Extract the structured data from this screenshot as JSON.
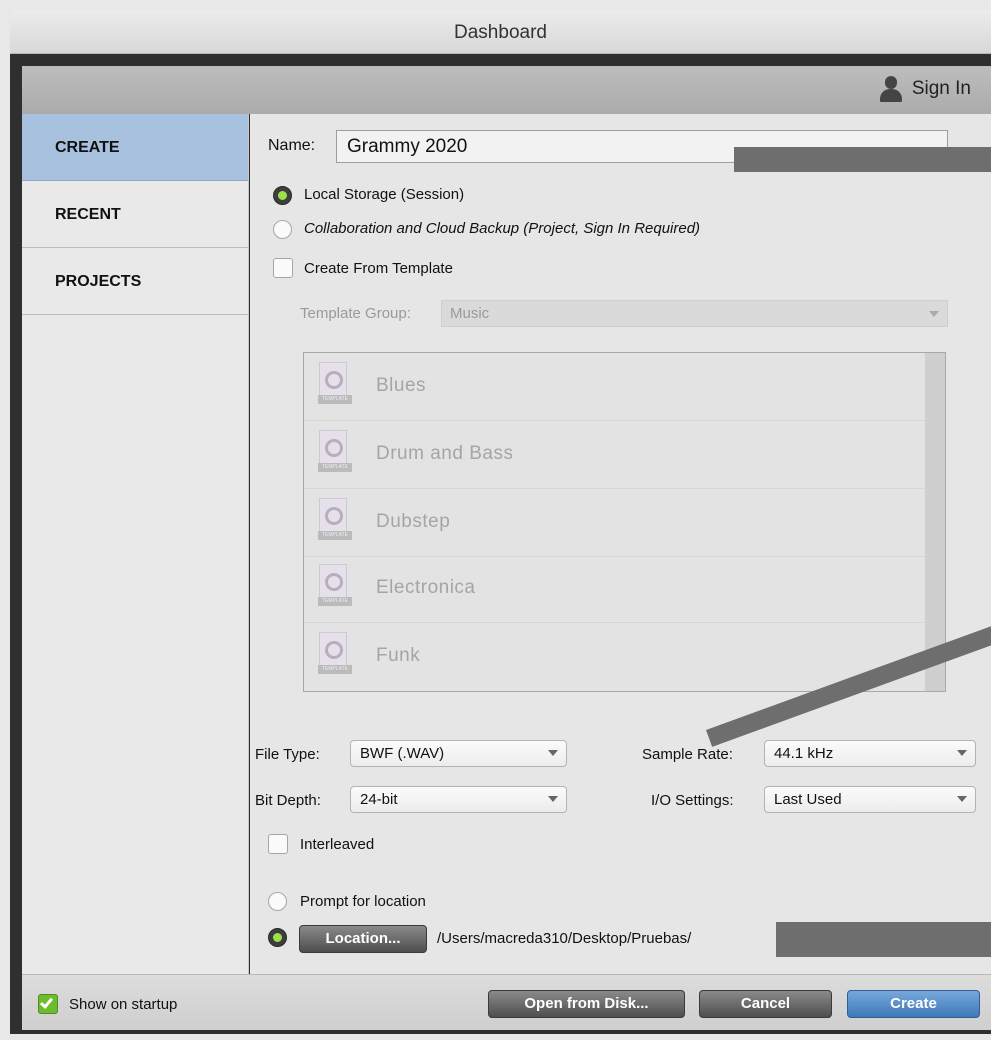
{
  "window": {
    "title": "Dashboard"
  },
  "topbar": {
    "sign_in": "Sign In"
  },
  "sidebar": {
    "items": [
      {
        "label": "CREATE",
        "active": true
      },
      {
        "label": "RECENT",
        "active": false
      },
      {
        "label": "PROJECTS",
        "active": false
      }
    ]
  },
  "create": {
    "name_label": "Name:",
    "name_value": "Grammy 2020",
    "local_storage": {
      "label": "Local Storage (Session)",
      "selected": true
    },
    "cloud": {
      "label": "Collaboration and Cloud Backup (Project, Sign In Required)",
      "selected": false
    },
    "from_template": {
      "label": "Create From Template",
      "checked": false
    },
    "template_group": {
      "label": "Template Group:",
      "value": "Music"
    },
    "templates": [
      {
        "name": "Blues",
        "tag": "TEMPLATE"
      },
      {
        "name": "Drum and Bass",
        "tag": "TEMPLATE"
      },
      {
        "name": "Dubstep",
        "tag": "TEMPLATE"
      },
      {
        "name": "Electronica",
        "tag": "TEMPLATE"
      },
      {
        "name": "Funk",
        "tag": "TEMPLATE"
      }
    ],
    "file_type": {
      "label": "File Type:",
      "value": "BWF (.WAV)"
    },
    "sample_rate": {
      "label": "Sample Rate:",
      "value": "44.1 kHz"
    },
    "bit_depth": {
      "label": "Bit Depth:",
      "value": "24-bit"
    },
    "io_settings": {
      "label": "I/O Settings:",
      "value": "Last Used"
    },
    "interleaved": {
      "label": "Interleaved",
      "checked": false
    },
    "prompt_location": {
      "label": "Prompt for location",
      "selected": false
    },
    "location": {
      "button": "Location...",
      "path": "/Users/macreda310/Desktop/Pruebas/",
      "selected": true
    }
  },
  "footer": {
    "show_on_startup": {
      "label": "Show on startup",
      "checked": true
    },
    "open_from_disk": "Open from Disk...",
    "cancel": "Cancel",
    "create": "Create"
  },
  "colors": {
    "accent_selected": "#a8c1df",
    "radio_active": "#9be24a",
    "primary_button": "#3f78b8"
  }
}
